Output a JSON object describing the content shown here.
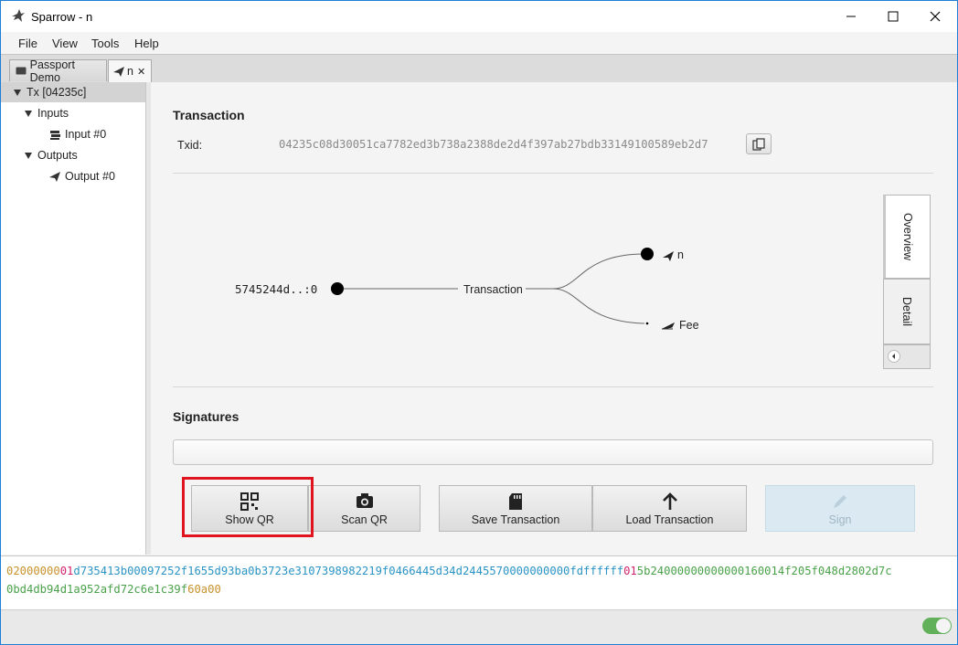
{
  "window": {
    "title": "Sparrow - n"
  },
  "menu": [
    "File",
    "View",
    "Tools",
    "Help"
  ],
  "tabs": [
    {
      "label": "Passport Demo",
      "icon": "wallet-icon"
    },
    {
      "label": "n",
      "icon": "paper-plane-icon",
      "close": "✕"
    }
  ],
  "tree": {
    "tx": "Tx [04235c]",
    "inputs": "Inputs",
    "input0": "Input #0",
    "outputs": "Outputs",
    "output0": "Output #0"
  },
  "transaction": {
    "heading": "Transaction",
    "txid_label": "Txid:",
    "txid": "04235c08d30051ca7782ed3b738a2388de2d4f397ab27bdb33149100589eb2d7"
  },
  "diagram": {
    "input": "5745244d..:0",
    "center": "Transaction",
    "output_label": "n",
    "fee_label": "Fee",
    "side_tabs": [
      "Overview",
      "Detail"
    ]
  },
  "signatures": {
    "heading": "Signatures"
  },
  "buttons": {
    "show_qr": "Show QR",
    "scan_qr": "Scan QR",
    "save": "Save Transaction",
    "load": "Load Transaction",
    "sign": "Sign"
  },
  "hex": {
    "version": "02000000",
    "input_count": "01",
    "inputs": "d735413b00097252f1655d93ba0b3723e3107398982219f0466445d34d2445570000000000fdffffff",
    "output_count": "01",
    "outputs_part1": "5b24000000000000160014f205f048d2802d7c",
    "outputs_part2": "0bd4db94d1a952afd72c6e1c39f",
    "locktime": "60a00"
  },
  "colors": {
    "accent_border": "#1d7fd6",
    "highlight": "#e0141e",
    "hex_version": "#c7922b",
    "hex_count": "#d2226d",
    "hex_input": "#2b94c4",
    "hex_output": "#4aa14a",
    "toggle_on": "#63b05a"
  }
}
